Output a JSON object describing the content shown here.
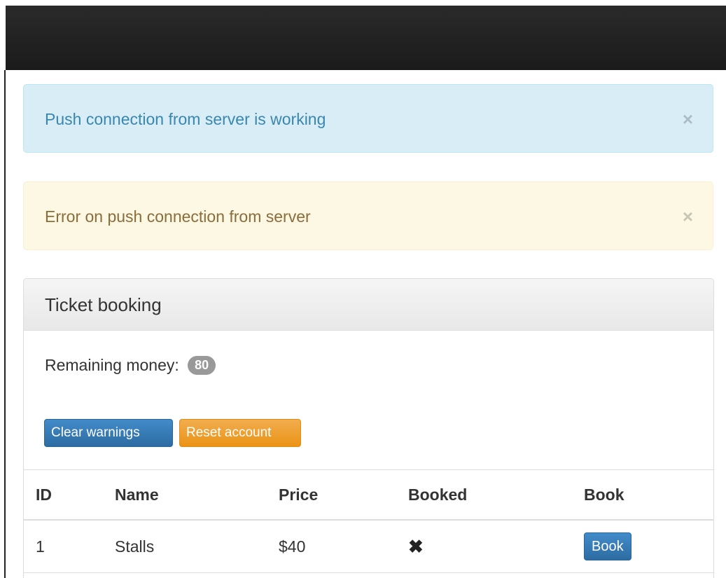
{
  "alerts": {
    "info": {
      "text": "Push connection from server is working",
      "close": "×"
    },
    "warning": {
      "text": "Error on push connection from server",
      "close": "×"
    }
  },
  "panel": {
    "title": "Ticket booking",
    "money_label": "Remaining money:",
    "money_value": "80",
    "buttons": {
      "clear": "Clear warnings",
      "reset": "Reset account"
    }
  },
  "table": {
    "headers": [
      "ID",
      "Name",
      "Price",
      "Booked",
      "Book"
    ],
    "rows": [
      {
        "id": "1",
        "name": "Stalls",
        "price": "$40",
        "booked": "✖",
        "book_label": "Book"
      }
    ]
  },
  "colors": {
    "primary": "#428bca",
    "warning": "#f0ad4e",
    "info_bg": "#d9edf7",
    "warning_bg": "#fcf8e3"
  }
}
